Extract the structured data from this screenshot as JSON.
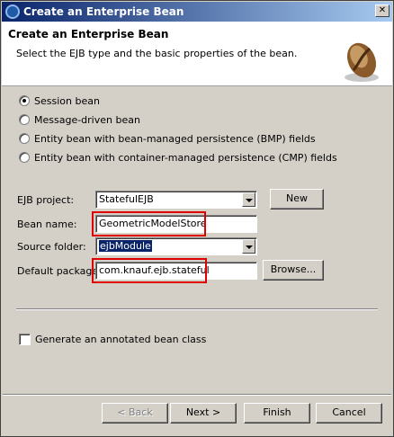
{
  "window": {
    "title": "Create an Enterprise Bean",
    "icon": "eclipse-icon",
    "close_label": "✕"
  },
  "header": {
    "title": "Create an Enterprise Bean",
    "description": "Select the EJB type and the basic properties of the bean.",
    "icon": "coffee-bean-icon"
  },
  "bean_types": {
    "selected": "Session bean",
    "options": [
      "Session bean",
      "Message-driven bean",
      "Entity bean with bean-managed persistence (BMP) fields",
      "Entity bean with container-managed persistence (CMP) fields"
    ]
  },
  "form": {
    "ejb_project": {
      "label": "EJB project:",
      "value": "StatefulEJB"
    },
    "bean_name": {
      "label": "Bean name:",
      "value": "GeometricModelStore"
    },
    "source_folder": {
      "label": "Source folder:",
      "value": "ejbModule"
    },
    "default_package": {
      "label": "Default package",
      "value": "com.knauf.ejb.stateful"
    },
    "new_button": "New",
    "browse_button": "Browse..."
  },
  "options": {
    "annotated_label": "Generate an annotated bean class",
    "annotated_checked": false
  },
  "footer": {
    "back": "< Back",
    "next": "Next >",
    "finish": "Finish",
    "cancel": "Cancel"
  },
  "colors": {
    "highlight": "#e00000",
    "title_bar": "#0a246a",
    "selection": "#0a246a"
  }
}
